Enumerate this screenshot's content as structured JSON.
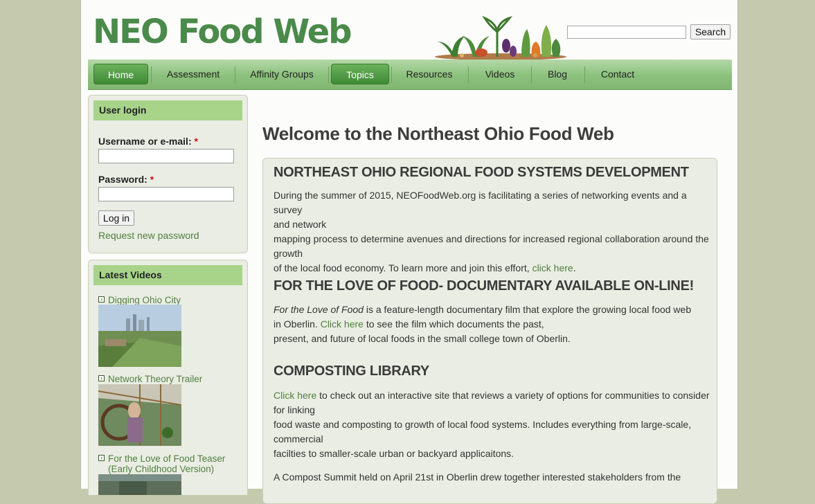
{
  "site": {
    "logo_text": "NEO Food Web"
  },
  "search": {
    "placeholder": "",
    "button_label": "Search"
  },
  "nav": {
    "items": [
      {
        "label": "Home",
        "active": true
      },
      {
        "label": "Assessment",
        "active": false
      },
      {
        "label": "Affinity Groups",
        "active": false
      },
      {
        "label": "Topics",
        "active": true
      },
      {
        "label": "Resources",
        "active": false
      },
      {
        "label": "Videos",
        "active": false
      },
      {
        "label": "Blog",
        "active": false
      },
      {
        "label": "Contact",
        "active": false
      }
    ]
  },
  "login": {
    "title": "User login",
    "username_label": "Username or e-mail:",
    "password_label": "Password:",
    "required_mark": "*",
    "button_label": "Log in",
    "request_password": "Request new password"
  },
  "videos": {
    "title": "Latest Videos",
    "items": [
      {
        "title": "Digging Ohio City"
      },
      {
        "title": "Network Theory Trailer"
      },
      {
        "title_line1": "For the Love of Food Teaser",
        "title_line2": "(Early Childhood Version)"
      }
    ]
  },
  "main": {
    "heading": "Welcome to the Northeast Ohio Food Web",
    "sections": [
      {
        "title": "NORTHEAST OHIO REGIONAL FOOD SYSTEMS DEVELOPMENT",
        "line1": "During the summer of 2015, NEOFoodWeb.org is facilitating a series of networking events and a survey",
        "line2": "and network",
        "line3": "mapping process to determine avenues and directions for increased regional collaboration around the",
        "line4": "growth",
        "line5_pre": "of the local food economy. To learn more and join this effort, ",
        "line5_link": "click here",
        "line5_post": "."
      },
      {
        "title": "FOR THE LOVE OF FOOD- DOCUMENTARY AVAILABLE ON-LINE!",
        "line1_em": "For the Love of Food",
        "line1_rest": " is a feature-length documentary film that explore the growing local food web",
        "line2_pre": "in Oberlin. ",
        "line2_link": "Click here",
        "line2_post": " to see the film which documents the past,",
        "line3": "present, and future of local foods in the small college town of Oberlin."
      },
      {
        "title": "COMPOSTING LIBRARY",
        "line1_link": "Click here",
        "line1_rest": " to check out an interactive site that reviews a variety of options for communities to consider",
        "line2": "for linking",
        "line3": "food waste and composting to growth of local food systems. Includes everything from large-scale,",
        "line4": "commercial",
        "line5": "facilties to smaller-scale urban or backyard applicaitons.",
        "line6": "A Compost Summit held on April 21st in Oberlin drew together interested stakeholders from the"
      }
    ]
  },
  "icons": {
    "search": "none",
    "video_bullet": "arrow-box-icon",
    "header_art": "vegetables-illustration"
  },
  "colors": {
    "brand_green": "#4a8a4a",
    "link_green": "#4f7f3f",
    "nav_green": "#8bc17c",
    "block_header": "#a8d48a",
    "background": "#c5c9ad"
  }
}
